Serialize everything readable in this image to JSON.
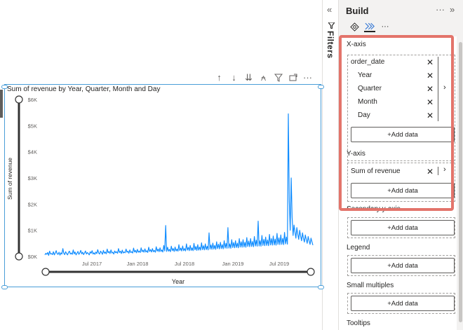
{
  "visual": {
    "title": "Sum of revenue by Year, Quarter, Month and Day",
    "toolbar_icons": [
      "drill-up-icon",
      "drill-down-icon",
      "expand-all-icon",
      "expand-hierarchy-icon",
      "filter-icon",
      "focus-mode-icon",
      "more-options-icon"
    ]
  },
  "chart_data": {
    "type": "line",
    "title": "Sum of revenue by Year, Quarter, Month and Day",
    "xlabel": "Year",
    "ylabel": "Sum of revenue",
    "x_ticks": [
      "Jul 2017",
      "Jan 2018",
      "Jul 2018",
      "Jan 2019",
      "Jul 2019"
    ],
    "y_ticks": [
      "$0K",
      "$1K",
      "$2K",
      "$3K",
      "$4K",
      "$5K",
      "$6K"
    ],
    "ylim": [
      0,
      6000
    ],
    "color": "#118dff",
    "series": [
      {
        "values": [
          60,
          120,
          80,
          150,
          40,
          200,
          90,
          110,
          70,
          180,
          60,
          130,
          220,
          100,
          80,
          160,
          50,
          140,
          90,
          300,
          120,
          70,
          180,
          110,
          60,
          150,
          200,
          90,
          130,
          80,
          250,
          100,
          170,
          60,
          120,
          190,
          80,
          140,
          230,
          100,
          160,
          70,
          130,
          210,
          90,
          150,
          110,
          60,
          180,
          120,
          220,
          90,
          140,
          80,
          170,
          110,
          260,
          130,
          90,
          200,
          150,
          80,
          230,
          120,
          170,
          100,
          280,
          140,
          190,
          110,
          250,
          130,
          160,
          90,
          210,
          140,
          180,
          120,
          300,
          150,
          200,
          110,
          240,
          130,
          170,
          140,
          280,
          160,
          200,
          120,
          250,
          150,
          180,
          130,
          320,
          170,
          230,
          140,
          270,
          160,
          210,
          150,
          330,
          180,
          240,
          160,
          290,
          170,
          220,
          150,
          350,
          190,
          260,
          170,
          300,
          180,
          230,
          160,
          370,
          200,
          280,
          180,
          330,
          190,
          250,
          170,
          420,
          210,
          1180,
          190,
          350,
          200,
          270,
          180,
          390,
          220,
          300,
          190,
          360,
          210,
          280,
          200,
          450,
          230,
          320,
          210,
          400,
          220,
          300,
          210,
          480,
          240,
          350,
          220,
          420,
          230,
          330,
          220,
          500,
          250,
          380,
          230,
          450,
          240,
          360,
          240,
          520,
          260,
          410,
          250,
          480,
          260,
          390,
          250,
          900,
          280,
          440,
          270,
          510,
          280,
          420,
          270,
          560,
          300,
          470,
          290,
          540,
          300,
          450,
          290,
          600,
          320,
          500,
          310,
          1100,
          320,
          480,
          310,
          640,
          340,
          530,
          330,
          600,
          340,
          510,
          330,
          680,
          360,
          560,
          350,
          640,
          360,
          540,
          350,
          720,
          380,
          590,
          370,
          680,
          380,
          570,
          370,
          760,
          400,
          620,
          390,
          1350,
          400,
          600,
          390,
          800,
          420,
          650,
          410,
          740,
          420,
          630,
          410,
          840,
          440,
          680,
          430,
          780,
          440,
          660,
          430,
          880,
          460,
          710,
          450,
          820,
          460,
          690,
          450,
          920,
          480,
          740,
          470,
          5450,
          2100,
          1000,
          3000,
          1500,
          800,
          1200,
          950,
          700,
          1100,
          850,
          650,
          1000,
          780,
          600,
          900,
          700,
          550,
          820,
          650,
          500,
          760,
          600,
          460,
          700,
          560,
          430
        ]
      }
    ]
  },
  "side_strip": {
    "collapse_icon": "double-chevron-left-icon",
    "filters_label": "Filters"
  },
  "pane": {
    "title": "Build",
    "more_label": "···",
    "expand_icon": "double-chevron-right-icon",
    "viz_more": "···",
    "x_axis": {
      "label": "X-axis",
      "fields": [
        {
          "name": "order_date"
        },
        {
          "name": "Year"
        },
        {
          "name": "Quarter"
        },
        {
          "name": "Month"
        },
        {
          "name": "Day"
        }
      ],
      "add_label": "+Add data"
    },
    "y_axis": {
      "label": "Y-axis",
      "fields": [
        {
          "name": "Sum of revenue"
        }
      ],
      "add_label": "+Add data"
    },
    "secondary_y": {
      "label": "Secondary y-axis",
      "add_label": "+Add data"
    },
    "legend": {
      "label": "Legend",
      "add_label": "+Add data"
    },
    "small_multiples": {
      "label": "Small multiples",
      "add_label": "+Add data"
    },
    "tooltips": {
      "label": "Tooltips"
    }
  },
  "colors": {
    "highlight": "#e3746b",
    "line": "#118dff",
    "selection": "#4a9ed8"
  }
}
